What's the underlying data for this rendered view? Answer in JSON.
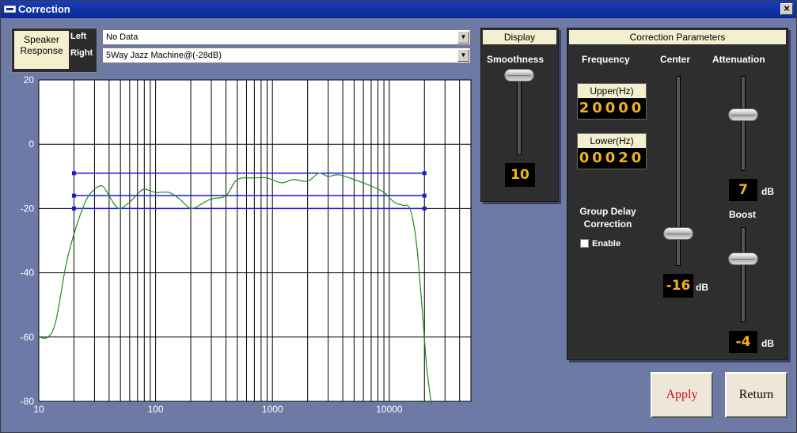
{
  "window": {
    "title": "Correction",
    "close_label": "×"
  },
  "speaker_response": {
    "label_line1": "Speaker",
    "label_line2": "Response",
    "left_label": "Left",
    "right_label": "Right"
  },
  "left_combo": {
    "value": "No Data",
    "arrow": "▼"
  },
  "right_combo": {
    "value": "5Way Jazz Machine@(-28dB)",
    "arrow": "▼"
  },
  "display": {
    "header": "Display",
    "smoothness_label": "Smoothness",
    "smoothness_value": "10"
  },
  "correction": {
    "header": "Correction Parameters",
    "frequency_label": "Frequency",
    "upper_label": "Upper(Hz)",
    "upper_value": "20000",
    "lower_label": "Lower(Hz)",
    "lower_value": "00020",
    "center_label": "Center",
    "center_value": "-16",
    "attenuation_label": "Attenuation",
    "attenuation_value": "7",
    "boost_label": "Boost",
    "boost_value": "-4",
    "unit": "dB",
    "group_delay_line1": "Group Delay",
    "group_delay_line2": "Correction",
    "enable_label": "Enable"
  },
  "buttons": {
    "apply": "Apply",
    "return": "Return"
  },
  "colors": {
    "apply_text": "#c41010",
    "lcd_text": "#f2b21c",
    "curve": "#1e8a1e",
    "bands": "#1a1ad6",
    "titlebar": "#0a2a98"
  },
  "chart_data": {
    "type": "line",
    "x_scale": "log",
    "xlim": [
      10,
      50000
    ],
    "ylim": [
      -80,
      20
    ],
    "x_ticks": [
      "10",
      "100",
      "1000",
      "10000"
    ],
    "y_ticks": [
      "20",
      "0",
      "-20",
      "-40",
      "-60",
      "-80"
    ],
    "grid": true,
    "series": [
      {
        "values": [
          [
            10,
            -60
          ],
          [
            12,
            -60
          ],
          [
            14,
            -55
          ],
          [
            17,
            -38
          ],
          [
            20,
            -28
          ],
          [
            25,
            -18
          ],
          [
            30,
            -14
          ],
          [
            35,
            -13
          ],
          [
            40,
            -16
          ],
          [
            45,
            -19
          ],
          [
            50,
            -20
          ],
          [
            60,
            -18
          ],
          [
            70,
            -15.5
          ],
          [
            80,
            -14
          ],
          [
            100,
            -15
          ],
          [
            130,
            -15
          ],
          [
            160,
            -17
          ],
          [
            200,
            -20
          ],
          [
            250,
            -18.5
          ],
          [
            300,
            -17
          ],
          [
            400,
            -16
          ],
          [
            500,
            -11
          ],
          [
            700,
            -10.5
          ],
          [
            900,
            -10.5
          ],
          [
            1200,
            -12
          ],
          [
            1500,
            -11
          ],
          [
            2000,
            -11.5
          ],
          [
            2500,
            -9
          ],
          [
            3000,
            -10
          ],
          [
            3700,
            -9.5
          ],
          [
            5000,
            -11
          ],
          [
            7000,
            -13
          ],
          [
            9000,
            -15
          ],
          [
            11000,
            -18
          ],
          [
            13000,
            -19
          ],
          [
            15000,
            -20
          ],
          [
            17000,
            -30
          ],
          [
            19000,
            -50
          ],
          [
            21000,
            -70
          ],
          [
            23000,
            -81
          ]
        ]
      }
    ],
    "bands": [
      {
        "level": -9,
        "from": 20,
        "to": 20000
      },
      {
        "level": -16,
        "from": 20,
        "to": 20000
      },
      {
        "level": -20,
        "from": 20,
        "to": 20000
      }
    ]
  }
}
